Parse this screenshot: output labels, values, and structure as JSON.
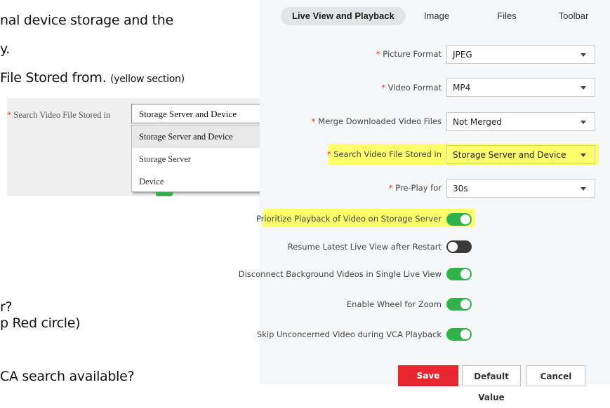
{
  "document": {
    "line1": "nal device storage and the",
    "line2": "y.",
    "line3_main": "File Stored from.",
    "line3_note": "(yellow section)",
    "line4": "r?",
    "line5": "p Red circle)",
    "line6": "CA search available?"
  },
  "left_snippet": {
    "label": "Search Video File Stored in",
    "selected": "Storage Server and Device",
    "options": [
      "Storage Server and Device",
      "Storage Server",
      "Device"
    ]
  },
  "tabs": [
    {
      "label": "Live View and Playback",
      "active": true
    },
    {
      "label": "Image",
      "active": false
    },
    {
      "label": "Files",
      "active": false
    },
    {
      "label": "Toolbar",
      "active": false
    }
  ],
  "settings": {
    "picture_format": {
      "label": "Picture Format",
      "value": "JPEG"
    },
    "video_format": {
      "label": "Video Format",
      "value": "MP4"
    },
    "merge_downloaded": {
      "label": "Merge Downloaded Video Files",
      "value": "Not Merged"
    },
    "search_stored_in": {
      "label": "Search Video File Stored in",
      "value": "Storage Server and Device"
    },
    "pre_play": {
      "label": "Pre-Play for",
      "value": "30s"
    }
  },
  "toggles": [
    {
      "label": "Prioritize Playback of Video on Storage Server",
      "on": true
    },
    {
      "label": "Resume Latest Live View after Restart",
      "on": false
    },
    {
      "label": "Disconnect Background Videos in Single Live View",
      "on": true
    },
    {
      "label": "Enable Wheel for Zoom",
      "on": true
    },
    {
      "label": "Skip Unconcerned Video during VCA Playback",
      "on": true
    }
  ],
  "required_marker": "*",
  "buttons": {
    "save": "Save",
    "default": "Default Value",
    "cancel": "Cancel"
  },
  "colors": {
    "accent_red": "#e8262d",
    "toggle_on": "#2fb24c",
    "highlight": "#ffff6b"
  }
}
